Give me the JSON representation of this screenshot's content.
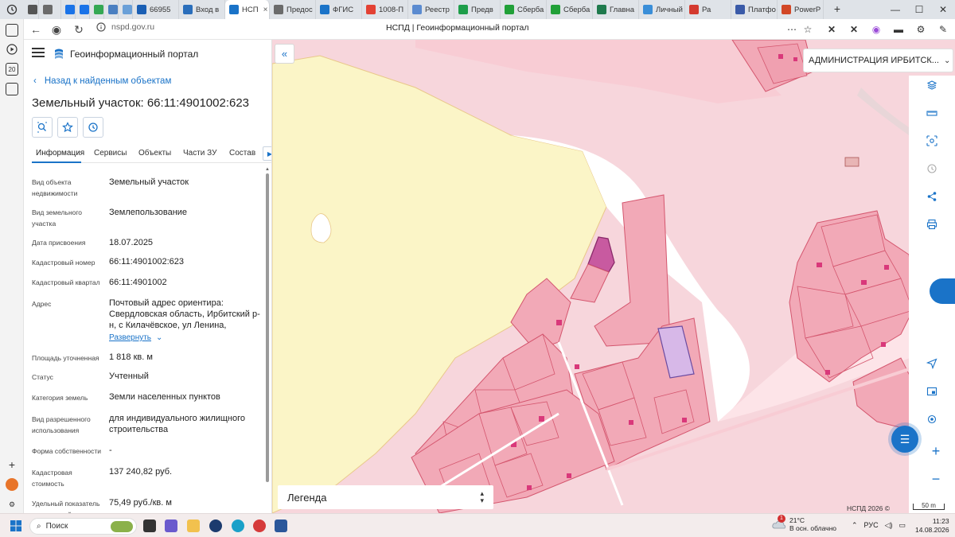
{
  "browser": {
    "tabs": [
      {
        "label": "",
        "color": "#555555"
      },
      {
        "label": "",
        "color": "#6b6b6b"
      },
      {
        "label": "",
        "color": "#1a73e8"
      },
      {
        "label": "",
        "color": "#1a73e8"
      },
      {
        "label": "",
        "color": "#34a853"
      },
      {
        "label": "",
        "color": "#4a7fc1"
      },
      {
        "label": "",
        "color": "#6aa0d8"
      },
      {
        "label": "66955",
        "color": "#1a5fb4"
      },
      {
        "label": "Вход в",
        "color": "#2a6ebb"
      },
      {
        "label": "НСП",
        "color": "#1a73c8",
        "active": true
      },
      {
        "label": "Предос",
        "color": "#6b6b6b"
      },
      {
        "label": "ФГИС",
        "color": "#1a73c8"
      },
      {
        "label": "1008-П",
        "color": "#e34133"
      },
      {
        "label": "Реестр",
        "color": "#5b8bd0"
      },
      {
        "label": "Предв",
        "color": "#1e9e4a"
      },
      {
        "label": "Сберба",
        "color": "#21a038"
      },
      {
        "label": "Сберба",
        "color": "#21a038"
      },
      {
        "label": "Главна",
        "color": "#1f7a4d"
      },
      {
        "label": "Личный",
        "color": "#3a8ed8"
      },
      {
        "label": "Ра",
        "color": "#d43a2f"
      },
      {
        "label": "Платфо",
        "color": "#3a5aa8"
      },
      {
        "label": "PowerP",
        "color": "#d24726"
      }
    ],
    "url": "nspd.gov.ru",
    "page_title": "НСПД | Геоинформационный портал"
  },
  "app": {
    "name": "Геоинформационный портал",
    "back_label": "Назад к найденным объектам",
    "object_title": "Земельный участок: 66:11:4901002:623",
    "tabs": [
      "Информация",
      "Сервисы",
      "Объекты",
      "Части ЗУ",
      "Состав"
    ],
    "fields": [
      {
        "label": "Вид объекта недвижимости",
        "value": "Земельный участок"
      },
      {
        "label": "Вид земельного участка",
        "value": "Землепользование"
      },
      {
        "label": "Дата присвоения",
        "value": "18.07.2025"
      },
      {
        "label": "Кадастровый номер",
        "value": "66:11:4901002:623"
      },
      {
        "label": "Кадастровый квартал",
        "value": "66:11:4901002"
      },
      {
        "label": "Адрес",
        "value": "Почтовый адрес ориентира: Свердловская область, Ирбитский р-н, с Килачёвское, ул Ленина,"
      },
      {
        "label": "Площадь уточненная",
        "value": "1 818 кв. м"
      },
      {
        "label": "Статус",
        "value": "Учтенный"
      },
      {
        "label": "Категория земель",
        "value": "Земли населенных пунктов"
      },
      {
        "label": "Вид разрешенного использования",
        "value": "для индивидуального жилищного строительства"
      },
      {
        "label": "Форма собственности",
        "value": "-"
      },
      {
        "label": "Кадастровая стоимость",
        "value": "137 240,82 руб."
      },
      {
        "label": "Удельный показатель кадастровой",
        "value": "75,49 руб./кв. м"
      }
    ],
    "expand_label": "Развернуть"
  },
  "map": {
    "admin_select": "АДМИНИСТРАЦИЯ ИРБИТСК...",
    "legend_label": "Легенда",
    "footer": "НСПД 2026 ©",
    "scale": "50 m",
    "colors": {
      "residential": "#f5b9c4",
      "parcel_stroke": "#d4566e",
      "field": "#fbf5c7",
      "selected": "#c85aa0",
      "building": "#d9387a"
    }
  },
  "taskbar": {
    "search_placeholder": "Поиск",
    "weather_temp": "21°C",
    "weather_desc": "В осн. облачно",
    "weather_badge": "1",
    "lang": "РУС",
    "time": "11:23",
    "date": "14.08.2026"
  }
}
